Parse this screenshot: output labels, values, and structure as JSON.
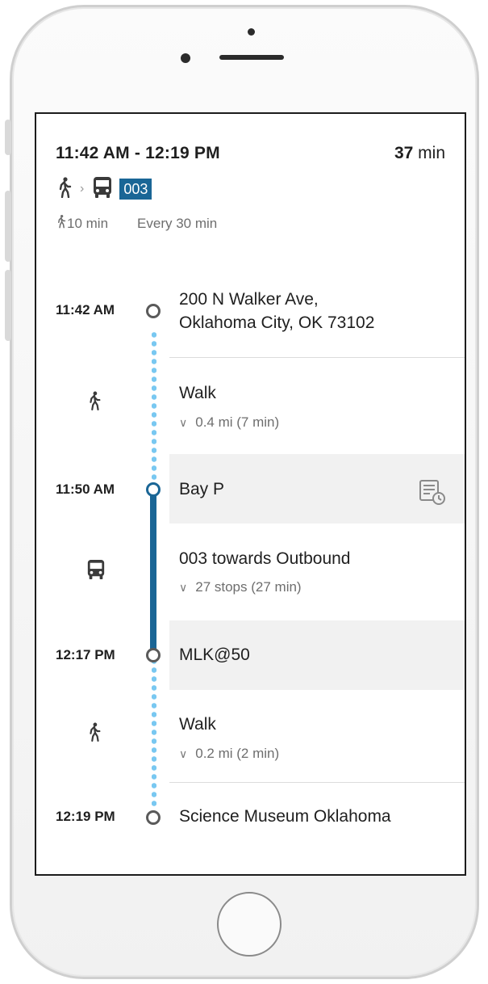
{
  "trip": {
    "time_range": "11:42 AM - 12:19 PM",
    "duration_value": "37",
    "duration_unit": "min",
    "route_badge": "003",
    "walk_total": "10 min",
    "frequency": "Every 30 min"
  },
  "stops": [
    {
      "time": "11:42 AM",
      "line1": "200 N Walker Ave,",
      "line2": "Oklahoma City, OK 73102"
    },
    {
      "time": "11:50 AM",
      "name": "Bay P"
    },
    {
      "time": "12:17 PM",
      "name": "MLK@50"
    },
    {
      "time": "12:19 PM",
      "name": "Science Museum Oklahoma"
    }
  ],
  "legs": [
    {
      "mode_icon": "walk-icon",
      "title": "Walk",
      "detail": "0.4 mi (7 min)"
    },
    {
      "mode_icon": "bus-icon",
      "title": "003 towards Outbound",
      "detail": "27 stops (27 min)"
    },
    {
      "mode_icon": "walk-icon",
      "title": "Walk",
      "detail": "0.2 mi (2 min)"
    }
  ],
  "colors": {
    "accent": "#1a6696",
    "dotted_walk": "#79c8f1",
    "stop_panel": "#f1f1f1"
  }
}
